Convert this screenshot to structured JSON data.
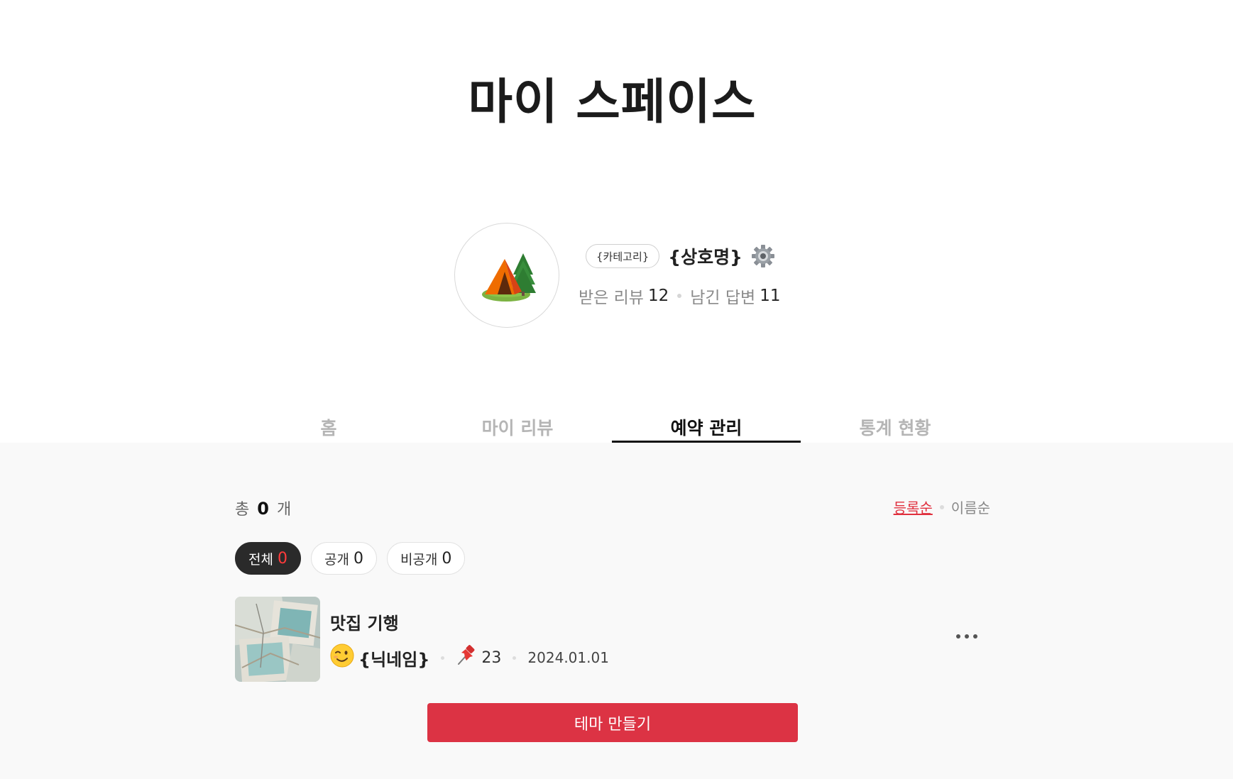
{
  "header": {
    "title": "마이 스페이스"
  },
  "profile": {
    "avatar_icon": "camping-tent-icon",
    "category": "{카테고리}",
    "store_name": "{상호명}",
    "settings_icon": "gear-icon",
    "received_reviews_label": "받은 리뷰",
    "received_reviews_count": "12",
    "replies_label": "남긴 답변",
    "replies_count": "11"
  },
  "tabs": [
    {
      "label": "홈",
      "active": false
    },
    {
      "label": "마이 리뷰",
      "active": false
    },
    {
      "label": "예약 관리",
      "active": true
    },
    {
      "label": "통계 현황",
      "active": false
    }
  ],
  "summary": {
    "prefix": "총",
    "count": "0",
    "suffix": "개"
  },
  "sort": {
    "options": [
      "등록순",
      "이름순"
    ],
    "active": "등록순"
  },
  "filters": [
    {
      "label": "전체",
      "count": "0",
      "active": true
    },
    {
      "label": "공개",
      "count": "0",
      "active": false
    },
    {
      "label": "비공개",
      "count": "0",
      "active": false
    }
  ],
  "items": [
    {
      "title": "맛집 기행",
      "author_icon": "winking-face-icon",
      "nickname": "{닉네임}",
      "pin_icon": "pushpin-icon",
      "pin_count": "23",
      "date": "2024.01.01"
    }
  ],
  "actions": {
    "create_label": "테마 만들기"
  },
  "colors": {
    "accent": "#dc3344",
    "sort_active": "#e0303e",
    "chip_active_bg": "#2a2a2a",
    "content_bg": "#f9f9f9"
  }
}
